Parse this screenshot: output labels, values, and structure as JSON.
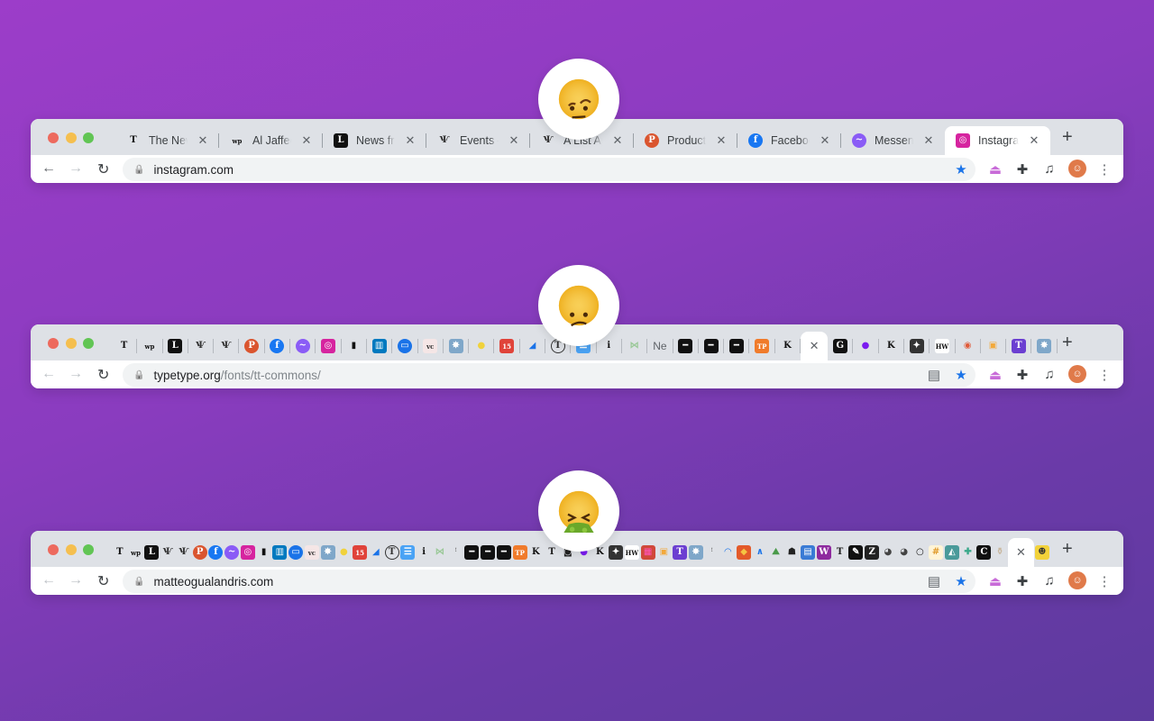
{
  "favicons": {
    "nyt": {
      "g": "T",
      "bg": "transparent",
      "fg": "#111"
    },
    "wp": {
      "g": "wp",
      "bg": "transparent",
      "fg": "#111"
    },
    "lit": {
      "g": "L",
      "bg": "#111",
      "fg": "#fff"
    },
    "ala": {
      "g": "Ѱ",
      "bg": "transparent",
      "fg": "#333"
    },
    "ph": {
      "g": "P",
      "bg": "#da552f",
      "fg": "#fff",
      "round": true
    },
    "fb": {
      "g": "f",
      "bg": "#1877f2",
      "fg": "#fff",
      "round": true
    },
    "msg": {
      "g": "~",
      "bg": "#8a5cf6",
      "fg": "#fff",
      "round": true
    },
    "ig": {
      "g": "◎",
      "bg": "#d6249f",
      "fg": "#fff"
    },
    "ghost": {
      "g": "▮",
      "bg": "transparent",
      "fg": "#111"
    },
    "trello": {
      "g": "▥",
      "bg": "#0079bf",
      "fg": "#fff"
    },
    "chat": {
      "g": "▭",
      "bg": "#1a73e8",
      "fg": "#fff",
      "round": true
    },
    "vc": {
      "g": "vc",
      "bg": "#f5e6e6",
      "fg": "#333"
    },
    "splash": {
      "g": "✸",
      "bg": "#7fa7c9",
      "fg": "#fff"
    },
    "sun": {
      "g": "●",
      "bg": "transparent",
      "fg": "#f0d23c"
    },
    "cal": {
      "g": "15",
      "bg": "#e0433a",
      "fg": "#fff"
    },
    "swoosh": {
      "g": "◢",
      "bg": "transparent",
      "fg": "#1a73e8"
    },
    "tcircle": {
      "g": "T",
      "bg": "transparent",
      "fg": "#333",
      "ring": true
    },
    "doc": {
      "g": "☰",
      "bg": "#4aa3f5",
      "fg": "#fff"
    },
    "ital": {
      "g": "i",
      "bg": "transparent",
      "fg": "#111"
    },
    "bow": {
      "g": "⋈",
      "bg": "transparent",
      "fg": "#9cc99a"
    },
    "dash": {
      "g": "━",
      "bg": "#111",
      "fg": "#fff"
    },
    "tptq": {
      "g": "TP",
      "bg": "#f07b2b",
      "fg": "#fff"
    },
    "frak": {
      "g": "K",
      "bg": "transparent",
      "fg": "#111"
    },
    "g": {
      "g": "G",
      "bg": "#111",
      "fg": "#fff"
    },
    "purple": {
      "g": "●",
      "bg": "transparent",
      "fg": "#7b1bf0"
    },
    "star": {
      "g": "✦",
      "bg": "#333",
      "fg": "#fff"
    },
    "hw": {
      "g": "HW",
      "bg": "#fff",
      "fg": "#111"
    },
    "globe": {
      "g": "◉",
      "bg": "transparent",
      "fg": "#e05b3a"
    },
    "abc": {
      "g": "▣",
      "bg": "transparent",
      "fg": "#f2a93b"
    },
    "tt": {
      "g": "T",
      "bg": "#6b3fd1",
      "fg": "#fff"
    },
    "tick": {
      "g": "ꜝ",
      "bg": "transparent",
      "fg": "#777"
    },
    "tplain": {
      "g": "T",
      "bg": "transparent",
      "fg": "#222"
    },
    "dark": {
      "g": "◙",
      "bg": "transparent",
      "fg": "#222"
    },
    "grid": {
      "g": "▦",
      "bg": "#d0483a",
      "fg": "#f5b"
    },
    "arc": {
      "g": "◠",
      "bg": "transparent",
      "fg": "#1a73e8"
    },
    "badge": {
      "g": "◆",
      "bg": "#e35a2a",
      "fg": "#f5c542"
    },
    "chev": {
      "g": "∧",
      "bg": "transparent",
      "fg": "#1a73e8"
    },
    "field": {
      "g": "⛰",
      "bg": "transparent",
      "fg": "#4a9a4a"
    },
    "hat": {
      "g": "☗",
      "bg": "transparent",
      "fg": "#222"
    },
    "book": {
      "g": "▤",
      "bg": "#3a7bd5",
      "fg": "#fff"
    },
    "w": {
      "g": "W",
      "bg": "#8e2a9e",
      "fg": "#fff"
    },
    "pen": {
      "g": "✎",
      "bg": "#111",
      "fg": "#fff"
    },
    "z": {
      "g": "Z",
      "bg": "#222",
      "fg": "#fff"
    },
    "earth": {
      "g": "◕",
      "bg": "transparent",
      "fg": "#444"
    },
    "ring": {
      "g": "○",
      "bg": "transparent",
      "fg": "#111"
    },
    "note": {
      "g": "#",
      "bg": "#fff4d6",
      "fg": "#e09a2a"
    },
    "bird": {
      "g": "◭",
      "bg": "#4a9a9a",
      "fg": "#fff"
    },
    "puzzle": {
      "g": "✚",
      "bg": "transparent",
      "fg": "#3aa88a"
    },
    "c": {
      "g": "C",
      "bg": "#111",
      "fg": "#fff"
    },
    "bottle": {
      "g": "⚱",
      "bg": "transparent",
      "fg": "#c9b8a0"
    },
    "bee": {
      "g": "☻",
      "bg": "#f2d23a",
      "fg": "#333"
    }
  },
  "windows": [
    {
      "emoji": "face-with-raised-eyebrow",
      "tabs": [
        {
          "icon": "nyt",
          "title": "The New Y"
        },
        {
          "icon": "wp",
          "title": "Al Jaffee t"
        },
        {
          "icon": "lit",
          "title": "News from"
        },
        {
          "icon": "ala",
          "title": "Events – A"
        },
        {
          "icon": "ala",
          "title": "A List Apa"
        },
        {
          "icon": "ph",
          "title": "Product H"
        },
        {
          "icon": "fb",
          "title": "Facebook"
        },
        {
          "icon": "msg",
          "title": "Messenger"
        },
        {
          "icon": "ig",
          "title": "Instagram",
          "active": true
        }
      ],
      "url_host": "instagram.com",
      "url_path": "",
      "reader_mode": false
    },
    {
      "emoji": "confused-face",
      "tabs": [
        {
          "icon": "nyt"
        },
        {
          "icon": "wp"
        },
        {
          "icon": "lit"
        },
        {
          "icon": "ala"
        },
        {
          "icon": "ala"
        },
        {
          "icon": "ph"
        },
        {
          "icon": "fb"
        },
        {
          "icon": "msg"
        },
        {
          "icon": "ig"
        },
        {
          "icon": "ghost"
        },
        {
          "icon": "trello"
        },
        {
          "icon": "chat"
        },
        {
          "icon": "vc"
        },
        {
          "icon": "splash"
        },
        {
          "icon": "sun"
        },
        {
          "icon": "cal"
        },
        {
          "icon": "swoosh"
        },
        {
          "icon": "tcircle"
        },
        {
          "icon": "doc"
        },
        {
          "icon": "ital"
        },
        {
          "icon": "bow"
        },
        {
          "title": "Ne"
        },
        {
          "icon": "dash"
        },
        {
          "icon": "dash"
        },
        {
          "icon": "dash"
        },
        {
          "icon": "tptq"
        },
        {
          "icon": "frak"
        },
        {
          "active": true
        },
        {
          "icon": "g"
        },
        {
          "icon": "purple"
        },
        {
          "icon": "frak"
        },
        {
          "icon": "star"
        },
        {
          "icon": "hw"
        },
        {
          "icon": "globe"
        },
        {
          "icon": "abc"
        },
        {
          "icon": "tt"
        },
        {
          "icon": "splash"
        }
      ],
      "url_host": "typetype.org",
      "url_path": "/fonts/tt-commons/",
      "reader_mode": true
    },
    {
      "emoji": "face-vomiting",
      "tabs": [
        {
          "icon": "nyt"
        },
        {
          "icon": "wp"
        },
        {
          "icon": "lit"
        },
        {
          "icon": "ala"
        },
        {
          "icon": "ala"
        },
        {
          "icon": "ph"
        },
        {
          "icon": "fb"
        },
        {
          "icon": "msg"
        },
        {
          "icon": "ig"
        },
        {
          "icon": "ghost"
        },
        {
          "icon": "trello"
        },
        {
          "icon": "chat"
        },
        {
          "icon": "vc"
        },
        {
          "icon": "splash"
        },
        {
          "icon": "sun"
        },
        {
          "icon": "cal"
        },
        {
          "icon": "swoosh"
        },
        {
          "icon": "tcircle"
        },
        {
          "icon": "doc"
        },
        {
          "icon": "ital"
        },
        {
          "icon": "bow"
        },
        {
          "icon": "tick"
        },
        {
          "icon": "dash"
        },
        {
          "icon": "dash"
        },
        {
          "icon": "dash"
        },
        {
          "icon": "tptq"
        },
        {
          "icon": "frak"
        },
        {
          "icon": "tplain"
        },
        {
          "icon": "dark"
        },
        {
          "icon": "purple"
        },
        {
          "icon": "frak"
        },
        {
          "icon": "star"
        },
        {
          "icon": "hw"
        },
        {
          "icon": "grid"
        },
        {
          "icon": "abc"
        },
        {
          "icon": "tt"
        },
        {
          "icon": "splash"
        },
        {
          "icon": "tick"
        },
        {
          "icon": "arc"
        },
        {
          "icon": "badge"
        },
        {
          "icon": "chev"
        },
        {
          "icon": "field"
        },
        {
          "icon": "hat"
        },
        {
          "icon": "book"
        },
        {
          "icon": "w"
        },
        {
          "icon": "tplain"
        },
        {
          "icon": "pen"
        },
        {
          "icon": "z"
        },
        {
          "icon": "earth"
        },
        {
          "icon": "earth"
        },
        {
          "icon": "ring"
        },
        {
          "icon": "note"
        },
        {
          "icon": "bird"
        },
        {
          "icon": "puzzle"
        },
        {
          "icon": "c"
        },
        {
          "icon": "bottle"
        },
        {
          "active": true
        },
        {
          "icon": "bee"
        }
      ],
      "url_host": "matteogualandris.com",
      "url_path": "",
      "reader_mode": true
    }
  ],
  "toolbar_icons": [
    "back-icon",
    "forward-icon",
    "reload-icon",
    "lock-icon",
    "reader-mode-icon",
    "bookmark-star-icon",
    "hanger-extension-icon",
    "extensions-puzzle-icon",
    "media-controls-icon",
    "profile-avatar",
    "more-menu-icon"
  ],
  "colors": {
    "star": "#1a73e8",
    "close_red": "#ed6a5e",
    "minimize_yellow": "#f5bf4f",
    "maximize_green": "#61c554"
  }
}
